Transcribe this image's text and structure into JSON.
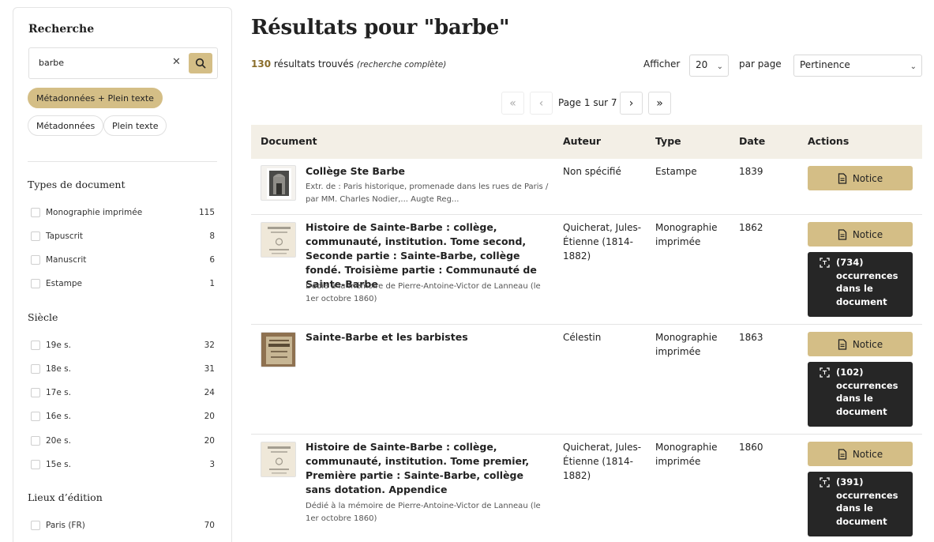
{
  "sidebar": {
    "title": "Recherche",
    "search": {
      "value": "barbe"
    },
    "modes": [
      "Métadonnées + Plein texte",
      "Métadonnées",
      "Plein texte"
    ],
    "sections": [
      {
        "title": "Types de document",
        "items": [
          {
            "label": "Monographie imprimée",
            "count": "115"
          },
          {
            "label": "Tapuscrit",
            "count": "8"
          },
          {
            "label": "Manuscrit",
            "count": "6"
          },
          {
            "label": "Estampe",
            "count": "1"
          }
        ]
      },
      {
        "title": "Siècle",
        "items": [
          {
            "label": "19e s.",
            "count": "32"
          },
          {
            "label": "18e s.",
            "count": "31"
          },
          {
            "label": "17e s.",
            "count": "24"
          },
          {
            "label": "16e s.",
            "count": "20"
          },
          {
            "label": "20e s.",
            "count": "20"
          },
          {
            "label": "15e s.",
            "count": "3"
          }
        ]
      },
      {
        "title": "Lieux d’édition",
        "items": [
          {
            "label": "Paris (FR)",
            "count": "70"
          }
        ]
      }
    ]
  },
  "main": {
    "title": "Résultats pour \"barbe\"",
    "count": "130",
    "count_suffix": "résultats trouvés",
    "search_note": "(recherche complète)",
    "show_label": "Afficher",
    "per_page_value": "20",
    "per_page_label": "par page",
    "sort_value": "Pertinence",
    "pagination": {
      "first": "«",
      "prev": "‹",
      "label": "Page 1 sur 7",
      "next": "›",
      "last": "»"
    }
  },
  "table": {
    "headers": [
      "Document",
      "Auteur",
      "Type",
      "Date",
      "Actions"
    ],
    "notice_label": "Notice",
    "rows": [
      {
        "title": "Collège Ste Barbe",
        "desc": "Extr. de : Paris historique, promenade dans les rues de Paris / par MM. Charles Nodier,... Augte Reg...",
        "author": "Non spécifié",
        "type": "Estampe",
        "date": "1839"
      },
      {
        "title": "Histoire de Sainte-Barbe : collège, communauté, institution. Tome second, Seconde partie : Sainte-Barbe, collège fondé. Troisième partie : Communauté de Sainte-Barbe",
        "desc": "Dédié à la mémoire de Pierre-Antoine-Victor de Lanneau (le 1er octobre 1860)",
        "author": "Quicherat, Jules-Étienne (1814-1882)",
        "type": "Monographie imprimée",
        "date": "1862",
        "occurrences": "(734) occurrences dans le document"
      },
      {
        "title": "Sainte-Barbe et les barbistes",
        "desc": "",
        "author": "Célestin",
        "type": "Monographie imprimée",
        "date": "1863",
        "occurrences": "(102) occurrences dans le document"
      },
      {
        "title": "Histoire de Sainte-Barbe : collège, communauté, institution. Tome premier, Première partie : Sainte-Barbe, collège sans dotation. Appendice",
        "desc": "Dédié à la mémoire de Pierre-Antoine-Victor de Lanneau (le 1er octobre 1860)",
        "author": "Quicherat, Jules-Étienne (1814-1882)",
        "type": "Monographie imprimée",
        "date": "1860",
        "occurrences": "(391) occurrences dans le document"
      }
    ]
  },
  "colors": {
    "accent": "#d4be86",
    "header_bg": "#f3efe6",
    "dark_button": "#262626",
    "count_color": "#8a6d2a"
  }
}
